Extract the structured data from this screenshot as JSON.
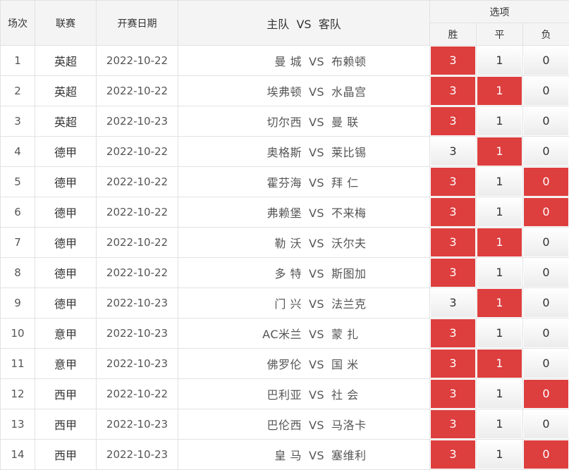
{
  "header": {
    "col_round": "场次",
    "col_league": "联赛",
    "col_date": "开赛日期",
    "col_match": "主队  VS  客队",
    "col_options": "选项",
    "opt_win": "胜",
    "opt_draw": "平",
    "opt_loss": "负"
  },
  "colors": {
    "selected": "#dd3e3e",
    "header_bg": "#f4f4f4"
  },
  "vs_label": "VS",
  "rows": [
    {
      "no": "1",
      "league": "英超",
      "date": "2022-10-22",
      "home": "曼 城",
      "away": "布赖顿",
      "win": "3",
      "draw": "1",
      "loss": "0",
      "sel_win": true,
      "sel_draw": false,
      "sel_loss": false
    },
    {
      "no": "2",
      "league": "英超",
      "date": "2022-10-22",
      "home": "埃弗顿",
      "away": "水晶宫",
      "win": "3",
      "draw": "1",
      "loss": "0",
      "sel_win": true,
      "sel_draw": true,
      "sel_loss": false
    },
    {
      "no": "3",
      "league": "英超",
      "date": "2022-10-23",
      "home": "切尔西",
      "away": "曼 联",
      "win": "3",
      "draw": "1",
      "loss": "0",
      "sel_win": true,
      "sel_draw": false,
      "sel_loss": false
    },
    {
      "no": "4",
      "league": "德甲",
      "date": "2022-10-22",
      "home": "奥格斯",
      "away": "莱比锡",
      "win": "3",
      "draw": "1",
      "loss": "0",
      "sel_win": false,
      "sel_draw": true,
      "sel_loss": false
    },
    {
      "no": "5",
      "league": "德甲",
      "date": "2022-10-22",
      "home": "霍芬海",
      "away": "拜 仁",
      "win": "3",
      "draw": "1",
      "loss": "0",
      "sel_win": true,
      "sel_draw": false,
      "sel_loss": true
    },
    {
      "no": "6",
      "league": "德甲",
      "date": "2022-10-22",
      "home": "弗赖堡",
      "away": "不来梅",
      "win": "3",
      "draw": "1",
      "loss": "0",
      "sel_win": true,
      "sel_draw": false,
      "sel_loss": true
    },
    {
      "no": "7",
      "league": "德甲",
      "date": "2022-10-22",
      "home": "勒 沃",
      "away": "沃尔夫",
      "win": "3",
      "draw": "1",
      "loss": "0",
      "sel_win": true,
      "sel_draw": true,
      "sel_loss": false
    },
    {
      "no": "8",
      "league": "德甲",
      "date": "2022-10-22",
      "home": "多 特",
      "away": "斯图加",
      "win": "3",
      "draw": "1",
      "loss": "0",
      "sel_win": true,
      "sel_draw": false,
      "sel_loss": false
    },
    {
      "no": "9",
      "league": "德甲",
      "date": "2022-10-23",
      "home": "门 兴",
      "away": "法兰克",
      "win": "3",
      "draw": "1",
      "loss": "0",
      "sel_win": false,
      "sel_draw": true,
      "sel_loss": false
    },
    {
      "no": "10",
      "league": "意甲",
      "date": "2022-10-23",
      "home": "AC米兰",
      "away": "蒙 扎",
      "win": "3",
      "draw": "1",
      "loss": "0",
      "sel_win": true,
      "sel_draw": false,
      "sel_loss": false
    },
    {
      "no": "11",
      "league": "意甲",
      "date": "2022-10-23",
      "home": "佛罗伦",
      "away": "国 米",
      "win": "3",
      "draw": "1",
      "loss": "0",
      "sel_win": true,
      "sel_draw": true,
      "sel_loss": false
    },
    {
      "no": "12",
      "league": "西甲",
      "date": "2022-10-22",
      "home": "巴利亚",
      "away": "社 会",
      "win": "3",
      "draw": "1",
      "loss": "0",
      "sel_win": true,
      "sel_draw": false,
      "sel_loss": true
    },
    {
      "no": "13",
      "league": "西甲",
      "date": "2022-10-23",
      "home": "巴伦西",
      "away": "马洛卡",
      "win": "3",
      "draw": "1",
      "loss": "0",
      "sel_win": true,
      "sel_draw": false,
      "sel_loss": false
    },
    {
      "no": "14",
      "league": "西甲",
      "date": "2022-10-23",
      "home": "皇 马",
      "away": "塞维利",
      "win": "3",
      "draw": "1",
      "loss": "0",
      "sel_win": true,
      "sel_draw": false,
      "sel_loss": true
    }
  ]
}
